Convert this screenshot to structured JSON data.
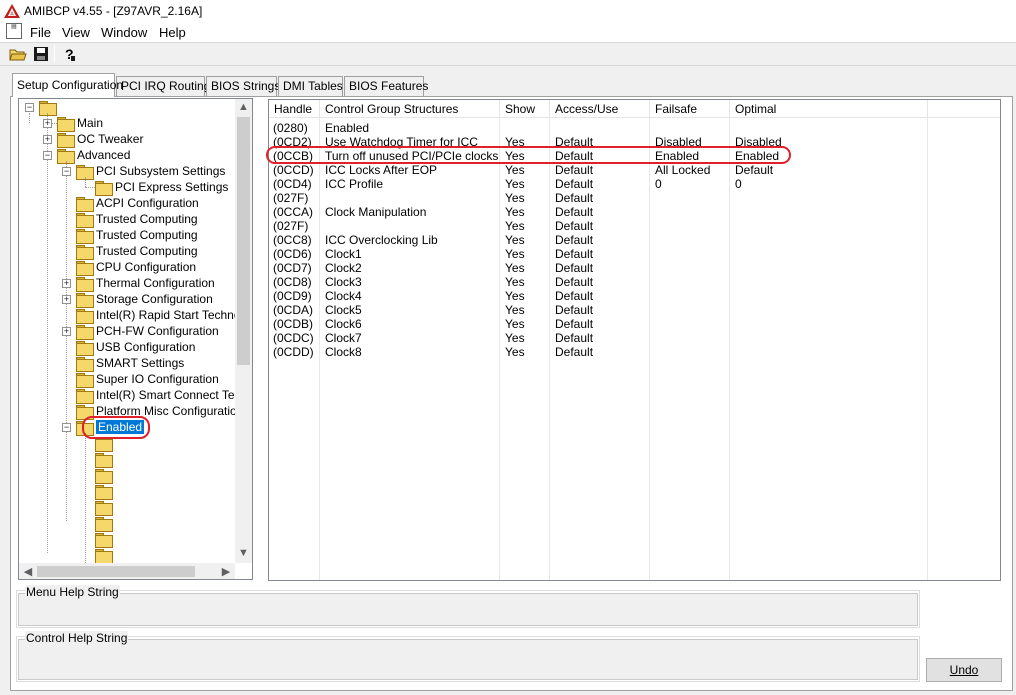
{
  "window": {
    "title": "AMIBCP v4.55 - [Z97AVR_2.16A]"
  },
  "menu": [
    "File",
    "View",
    "Window",
    "Help"
  ],
  "toolbar": {
    "icons": [
      "open-folder-icon",
      "save-disk-icon",
      "help-icon"
    ]
  },
  "tabs": [
    "Setup Configuration",
    "PCI IRQ Routing",
    "BIOS Strings",
    "DMI Tables",
    "BIOS Features"
  ],
  "tree": {
    "items": [
      {
        "label": "Main",
        "expander": "+"
      },
      {
        "label": "OC Tweaker",
        "expander": "+"
      },
      {
        "label": "Advanced",
        "expander": "−"
      },
      {
        "label": "PCI Subsystem Settings",
        "expander": "−"
      },
      {
        "label": "PCI Express Settings",
        "expander": ""
      },
      {
        "label": "ACPI Configuration",
        "expander": ""
      },
      {
        "label": "Trusted Computing",
        "expander": ""
      },
      {
        "label": "Trusted Computing",
        "expander": ""
      },
      {
        "label": "Trusted Computing",
        "expander": ""
      },
      {
        "label": "CPU Configuration",
        "expander": ""
      },
      {
        "label": "Thermal Configuration",
        "expander": "+"
      },
      {
        "label": "Storage Configuration",
        "expander": "+"
      },
      {
        "label": "Intel(R) Rapid Start Technolo",
        "expander": ""
      },
      {
        "label": "PCH-FW Configuration",
        "expander": "+"
      },
      {
        "label": "USB Configuration",
        "expander": ""
      },
      {
        "label": "SMART Settings",
        "expander": ""
      },
      {
        "label": "Super IO Configuration",
        "expander": ""
      },
      {
        "label": "Intel(R) Smart Connect Techr",
        "expander": ""
      },
      {
        "label": "Platform Misc Configuration",
        "expander": ""
      },
      {
        "label": "Enabled",
        "expander": "−"
      }
    ]
  },
  "list": {
    "columns": [
      "Handle",
      "Control Group Structures",
      "Show",
      "Access/Use",
      "Failsafe",
      "Optimal"
    ],
    "rows": [
      [
        "(0280)",
        "Enabled",
        "",
        "",
        "",
        ""
      ],
      [
        "(0CD2)",
        "Use Watchdog Timer for ICC",
        "Yes",
        "Default",
        "Disabled",
        "Disabled"
      ],
      [
        "(0CCB)",
        "Turn off unused PCI/PCIe clocks",
        "Yes",
        "Default",
        "Enabled",
        "Enabled"
      ],
      [
        "(0CCD)",
        "ICC Locks After EOP",
        "Yes",
        "Default",
        "All Locked",
        "Default"
      ],
      [
        "(0CD4)",
        "ICC Profile",
        "Yes",
        "Default",
        "0",
        "0"
      ],
      [
        "(027F)",
        "",
        "Yes",
        "Default",
        "",
        ""
      ],
      [
        "(0CCA)",
        "Clock Manipulation",
        "Yes",
        "Default",
        "",
        ""
      ],
      [
        "(027F)",
        "",
        "Yes",
        "Default",
        "",
        ""
      ],
      [
        "(0CC8)",
        "ICC Overclocking Lib",
        "Yes",
        "Default",
        "",
        ""
      ],
      [
        "(0CD6)",
        "Clock1",
        "Yes",
        "Default",
        "",
        ""
      ],
      [
        "(0CD7)",
        "Clock2",
        "Yes",
        "Default",
        "",
        ""
      ],
      [
        "(0CD8)",
        "Clock3",
        "Yes",
        "Default",
        "",
        ""
      ],
      [
        "(0CD9)",
        "Clock4",
        "Yes",
        "Default",
        "",
        ""
      ],
      [
        "(0CDA)",
        "Clock5",
        "Yes",
        "Default",
        "",
        ""
      ],
      [
        "(0CDB)",
        "Clock6",
        "Yes",
        "Default",
        "",
        ""
      ],
      [
        "(0CDC)",
        "Clock7",
        "Yes",
        "Default",
        "",
        ""
      ],
      [
        "(0CDD)",
        "Clock8",
        "Yes",
        "Default",
        "",
        ""
      ]
    ]
  },
  "help": {
    "menu_label": "Menu Help String",
    "control_label": "Control Help String"
  },
  "buttons": {
    "undo": "Undo"
  },
  "colors": {
    "annotation": "#e0202a",
    "selection": "#0078d7"
  }
}
